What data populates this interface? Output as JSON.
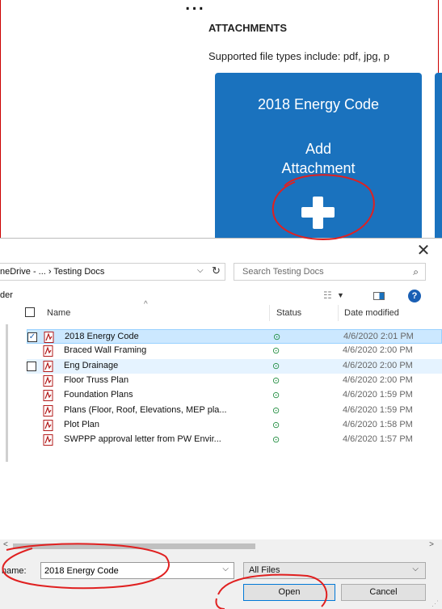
{
  "page": {
    "attachments_heading": "ATTACHMENTS",
    "supported_text": "Supported file types include: pdf, jpg, p",
    "cards": [
      {
        "title": "2018 Energy Code",
        "add_line1": "Add",
        "add_line2": "Attachment"
      }
    ]
  },
  "dialog": {
    "breadcrumb": "neDrive - ...  ›  Testing Docs",
    "search_placeholder": "Search Testing Docs",
    "organize_label": "der",
    "columns": {
      "name": "Name",
      "status": "Status",
      "date": "Date modified"
    },
    "files": [
      {
        "name": "2018 Energy Code",
        "status": "⊙",
        "date": "4/6/2020 2:01 PM",
        "checked": true,
        "selected": true
      },
      {
        "name": "Braced Wall Framing",
        "status": "⊙",
        "date": "4/6/2020 2:00 PM"
      },
      {
        "name": "Eng Drainage",
        "status": "⊙",
        "date": "4/6/2020 2:00 PM",
        "hover": true
      },
      {
        "name": "Floor Truss Plan",
        "status": "⊙",
        "date": "4/6/2020 2:00 PM"
      },
      {
        "name": "Foundation Plans",
        "status": "⊙",
        "date": "4/6/2020 1:59 PM"
      },
      {
        "name": "Plans (Floor, Roof, Elevations, MEP pla...",
        "status": "⊙",
        "date": "4/6/2020 1:59 PM"
      },
      {
        "name": "Plot Plan",
        "status": "⊙",
        "date": "4/6/2020 1:58 PM"
      },
      {
        "name": "SWPPP approval letter from PW Envir...",
        "status": "⊙",
        "date": "4/6/2020 1:57 PM"
      }
    ],
    "filename_label": "name:",
    "filename_value": "2018 Energy Code",
    "filetype_value": "All Files",
    "open_label": "Open",
    "cancel_label": "Cancel"
  },
  "icons": {
    "close": "close-icon",
    "refresh": "refresh-icon",
    "search": "search-icon",
    "file": "pdf-file-icon",
    "help": "help-icon",
    "plus": "plus-icon"
  },
  "colors": {
    "card_blue": "#1a72be",
    "selection": "#cce8ff",
    "annotation_red": "#e02020",
    "status_green": "#1a8a3a"
  }
}
